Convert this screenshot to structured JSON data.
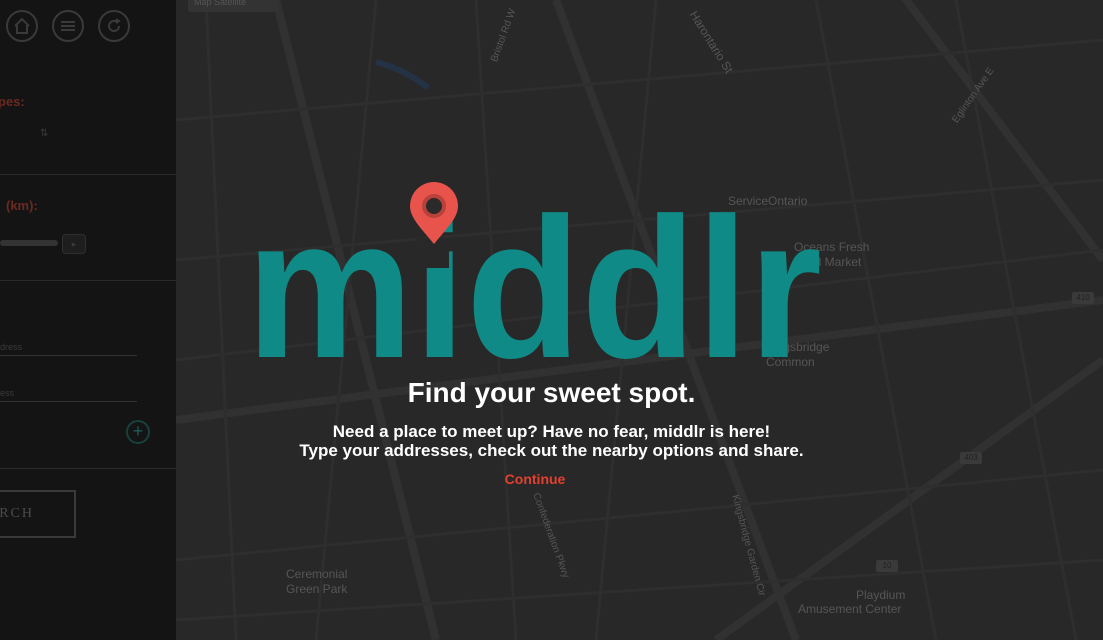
{
  "sidebar": {
    "icons": [
      "home-icon",
      "list-icon",
      "refresh-icon"
    ],
    "label_types": "pes:",
    "label_km": "(km):",
    "stepper_value": "1",
    "address_placeholder_1": "dress",
    "address_placeholder_2": "ess",
    "search_label": "RCH"
  },
  "map": {
    "tab_label": "Map    Satellite",
    "labels": [
      "Harontario St",
      "ServiceOntario",
      "Oceans Fresh",
      "Food Market",
      "Kingsbridge",
      "Common",
      "Ceremonial",
      "Green Park",
      "Playdium",
      "Amusement Center",
      "Eglinton Ave E",
      "Bristol Rd W",
      "Confederation Pkwy",
      "Kingsbridge Garden Cir"
    ],
    "shields": [
      "410",
      "403",
      "10"
    ]
  },
  "splash": {
    "brand": "middlr",
    "headline": "Find your sweet spot.",
    "line1": "Need a place to meet up? Have no fear, middlr is here!",
    "line2": "Type your addresses, check out the nearby options and share.",
    "continue": "Continue"
  },
  "colors": {
    "brand_teal": "#0f8a86",
    "pin_red": "#e8544b",
    "continue_red": "#e2412f"
  }
}
